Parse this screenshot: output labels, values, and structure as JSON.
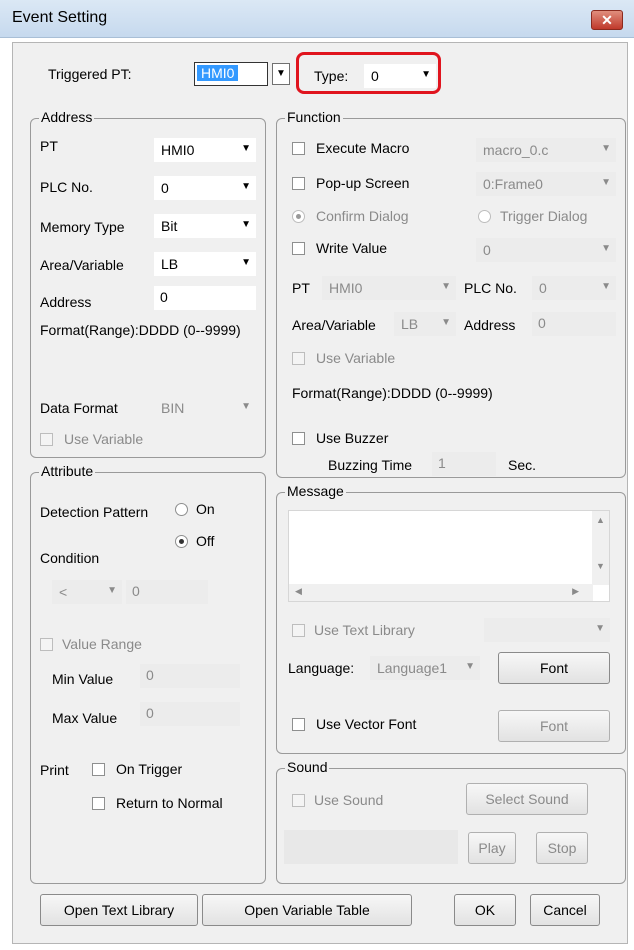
{
  "window": {
    "title": "Event Setting",
    "close_icon": "close-icon"
  },
  "top": {
    "triggered_pt_label": "Triggered PT:",
    "triggered_pt_value": "HMI0",
    "type_label": "Type:",
    "type_value": "0"
  },
  "address": {
    "title": "Address",
    "pt_label": "PT",
    "pt_value": "HMI0",
    "plc_label": "PLC No.",
    "plc_value": "0",
    "memtype_label": "Memory Type",
    "memtype_value": "Bit",
    "area_label": "Area/Variable",
    "area_value": "LB",
    "address_label": "Address",
    "address_value": "0",
    "format_text": "Format(Range):DDDD (0--9999)",
    "dataformat_label": "Data Format",
    "dataformat_value": "BIN",
    "use_variable_label": "Use Variable"
  },
  "attribute": {
    "title": "Attribute",
    "detection_label": "Detection Pattern",
    "on_label": "On",
    "off_label": "Off",
    "condition_label": "Condition",
    "condition_op": "<",
    "condition_value": "0",
    "value_range_label": "Value Range",
    "min_label": "Min Value",
    "min_value": "0",
    "max_label": "Max Value",
    "max_value": "0",
    "print_label": "Print",
    "on_trigger_label": "On Trigger",
    "return_normal_label": "Return to Normal"
  },
  "function": {
    "title": "Function",
    "exec_macro_label": "Execute Macro",
    "macro_value": "macro_0.c",
    "popup_label": "Pop-up Screen",
    "popup_value": "0:Frame0",
    "confirm_label": "Confirm Dialog",
    "trigger_label": "Trigger Dialog",
    "write_label": "Write Value",
    "write_value": "0",
    "pt_label": "PT",
    "pt_value": "HMI0",
    "plc_label": "PLC No.",
    "plc_value": "0",
    "area_label": "Area/Variable",
    "area_value": "LB",
    "address_label": "Address",
    "address_value": "0",
    "use_variable_label": "Use Variable",
    "format_text": "Format(Range):DDDD (0--9999)",
    "buzzer_label": "Use Buzzer",
    "buzz_time_label": "Buzzing Time",
    "buzz_time_value": "1",
    "sec_label": "Sec."
  },
  "message": {
    "title": "Message",
    "use_text_lib_label": "Use Text Library",
    "language_label": "Language:",
    "language_value": "Language1",
    "font_button": "Font",
    "vector_font_label": "Use Vector Font",
    "font_button2": "Font"
  },
  "sound": {
    "title": "Sound",
    "use_sound_label": "Use Sound",
    "select_sound": "Select Sound",
    "play": "Play",
    "stop": "Stop"
  },
  "footer": {
    "open_text_lib": "Open Text Library",
    "open_var_table": "Open Variable Table",
    "ok": "OK",
    "cancel": "Cancel"
  }
}
